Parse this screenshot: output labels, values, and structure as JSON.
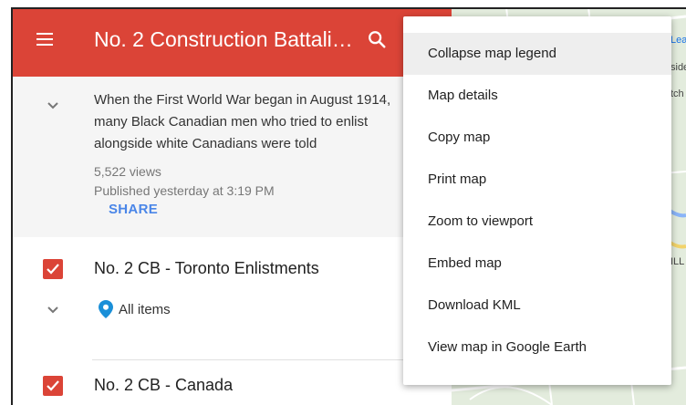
{
  "toolbar": {
    "title": "No. 2 Construction Battali…"
  },
  "description": {
    "text": "When the First World War began in August 1914, many Black Canadian men who tried to enlist alongside white Canadians were told",
    "views": "5,522 views",
    "published": "Published yesterday at 3:19 PM",
    "share_label": "SHARE"
  },
  "layers": [
    {
      "name": "No. 2 CB - Toronto Enlistments",
      "sub_label": "All items"
    },
    {
      "name": "No. 2 CB - Canada"
    }
  ],
  "menu": {
    "items": [
      "Collapse map legend",
      "Map details",
      "Copy map",
      "Print map",
      "Zoom to viewport",
      "Embed map",
      "Download KML",
      "View map in Google Earth"
    ]
  },
  "map": {
    "fragments": [
      "Lea",
      "side",
      "tch",
      "ILL"
    ]
  },
  "colors": {
    "accent": "#db4437",
    "link": "#4a86e8",
    "pin": "#1a8fd8"
  }
}
